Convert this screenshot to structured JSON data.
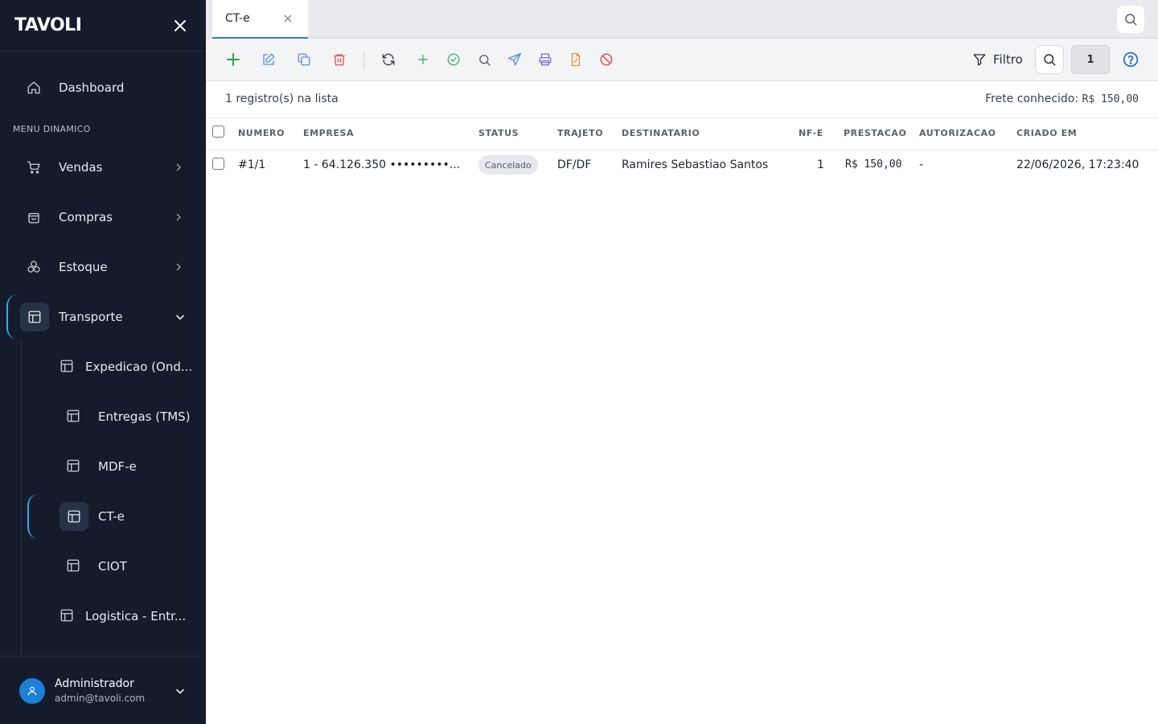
{
  "sidebar": {
    "logo": "TAVOLI",
    "section_label": "MENU DINAMICO",
    "items": [
      {
        "label": "Dashboard"
      },
      {
        "label": "Vendas"
      },
      {
        "label": "Compras"
      },
      {
        "label": "Estoque"
      },
      {
        "label": "Transporte"
      }
    ],
    "sub_items": [
      {
        "label": "Expedicao (Ond..."
      },
      {
        "label": "Entregas (TMS)"
      },
      {
        "label": "MDF-e"
      },
      {
        "label": "CT-e"
      },
      {
        "label": "CIOT"
      },
      {
        "label": "Logistica - Entr..."
      }
    ],
    "user": {
      "name": "Administrador",
      "email": "admin@tavoli.com"
    }
  },
  "tabs": [
    {
      "label": "CT-e"
    }
  ],
  "toolbar": {
    "filter_label": "Filtro",
    "page_number": "1",
    "icons": [
      "plus-icon",
      "edit-icon",
      "copy-icon",
      "trash-icon",
      "refresh-icon",
      "plus-icon",
      "check-circle-icon",
      "search-icon",
      "send-icon",
      "printer-icon",
      "file-icon",
      "ban-icon"
    ]
  },
  "summary": {
    "count_text": "1 registro(s) na lista",
    "frete_label": "Frete conhecido:",
    "frete_value": "R$ 150,00"
  },
  "table": {
    "columns": [
      "NUMERO",
      "EMPRESA",
      "STATUS",
      "TRAJETO",
      "DESTINATARIO",
      "NF-E",
      "PRESTACAO",
      "AUTORIZACAO",
      "CRIADO EM"
    ],
    "rows": [
      {
        "numero": "#1/1",
        "empresa": "1 - 64.126.350 •••••••••...",
        "status": "Cancelado",
        "trajeto": "DF/DF",
        "destinatario": "Ramires Sebastiao Santos",
        "nfe": "1",
        "prestacao": "R$ 150,00",
        "autorizacao": "-",
        "criado_em": "22/06/2026, 17:23:40"
      }
    ]
  },
  "colors": {
    "sidebar_bg": "#141b2d",
    "accent": "#2a7fd9",
    "active_indicator": "#38a8e0"
  }
}
